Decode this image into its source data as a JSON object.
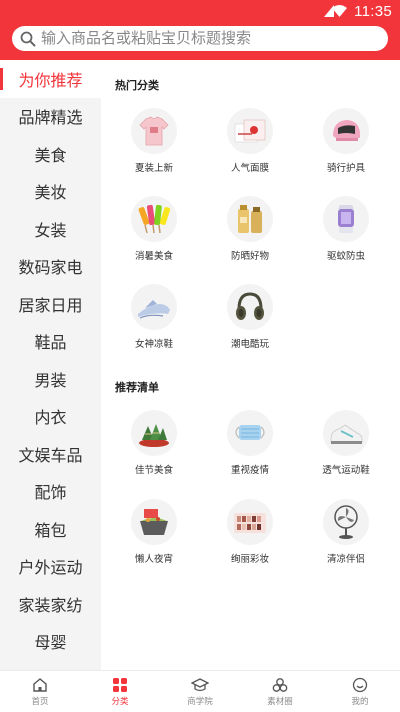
{
  "status": {
    "time": "11:35"
  },
  "search": {
    "placeholder": "输入商品名或粘贴宝贝标题搜索"
  },
  "sidebar": {
    "items": [
      {
        "label": "为你推荐",
        "active": true
      },
      {
        "label": "品牌精选"
      },
      {
        "label": "美食"
      },
      {
        "label": "美妆"
      },
      {
        "label": "女装"
      },
      {
        "label": "数码家电"
      },
      {
        "label": "居家日用"
      },
      {
        "label": "鞋品"
      },
      {
        "label": "男装"
      },
      {
        "label": "内衣"
      },
      {
        "label": "文娱车品"
      },
      {
        "label": "配饰"
      },
      {
        "label": "箱包"
      },
      {
        "label": "户外运动"
      },
      {
        "label": "家装家纺"
      },
      {
        "label": "母婴"
      }
    ]
  },
  "hot": {
    "title": "热门分类",
    "items": [
      {
        "label": "夏装上新",
        "icon": "tshirt-icon"
      },
      {
        "label": "人气面膜",
        "icon": "facemask-icon"
      },
      {
        "label": "骑行护具",
        "icon": "helmet-icon"
      },
      {
        "label": "消暑美食",
        "icon": "popsicle-icon"
      },
      {
        "label": "防晒好物",
        "icon": "sunscreen-icon"
      },
      {
        "label": "驱蚊防虫",
        "icon": "mosquito-lamp-icon"
      },
      {
        "label": "女神凉鞋",
        "icon": "sandal-icon"
      },
      {
        "label": "潮电酷玩",
        "icon": "headphones-icon"
      }
    ]
  },
  "recommend": {
    "title": "推荐清单",
    "items": [
      {
        "label": "佳节美食",
        "icon": "zongzi-icon"
      },
      {
        "label": "重视疫情",
        "icon": "medical-mask-icon"
      },
      {
        "label": "透气运动鞋",
        "icon": "sneaker-icon"
      },
      {
        "label": "懒人夜宵",
        "icon": "snack-bowl-icon"
      },
      {
        "label": "绚丽彩妆",
        "icon": "eyeshadow-palette-icon"
      },
      {
        "label": "清凉伴侣",
        "icon": "fan-icon"
      }
    ]
  },
  "tabbar": {
    "items": [
      {
        "label": "首页",
        "icon": "home-icon"
      },
      {
        "label": "分类",
        "icon": "category-icon",
        "active": true
      },
      {
        "label": "商学院",
        "icon": "graduation-cap-icon"
      },
      {
        "label": "素材圈",
        "icon": "material-circle-icon"
      },
      {
        "label": "我的",
        "icon": "profile-icon"
      }
    ]
  },
  "colors": {
    "accent": "#f2353b",
    "sidebar_bg": "#f4f4f4"
  }
}
